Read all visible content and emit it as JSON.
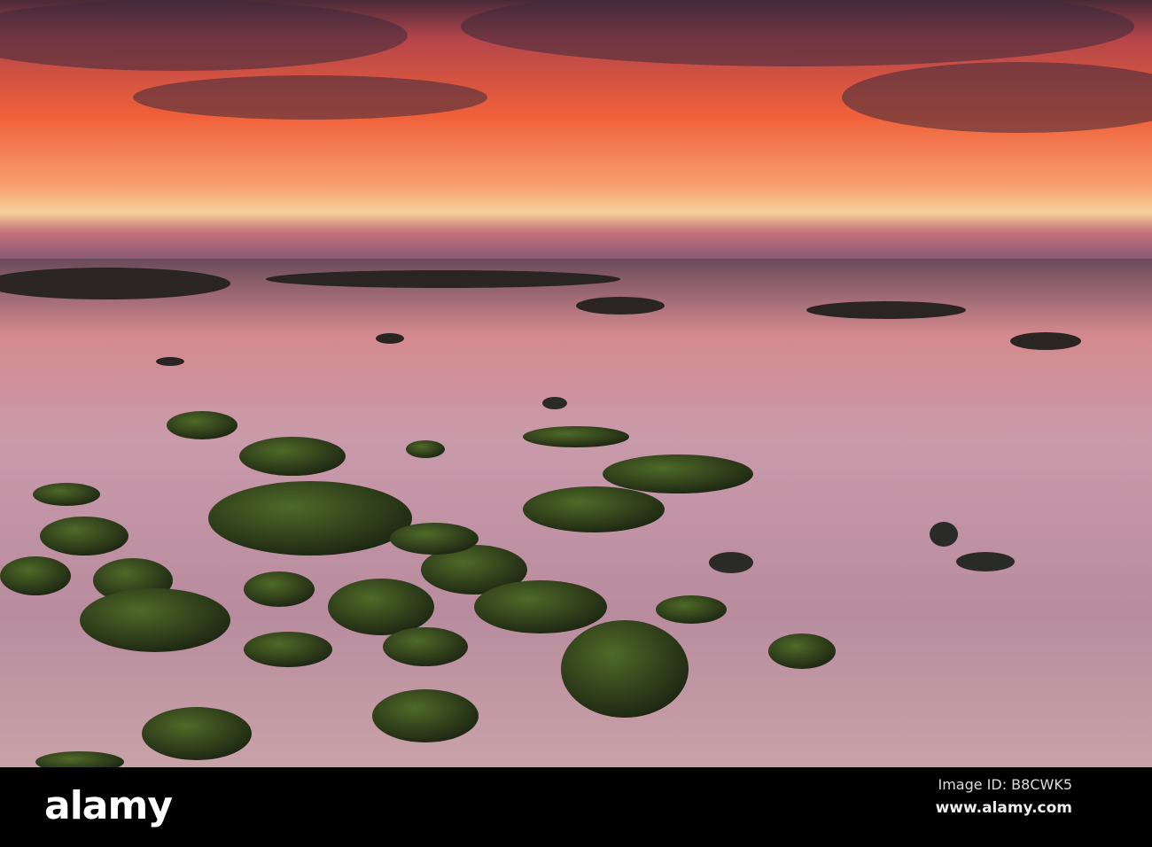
{
  "watermark": {
    "logo": "alamy",
    "image_id": "Image ID: B8CWK5",
    "url": "www.alamy.com"
  },
  "colors": {
    "sky_top": "#3a2530",
    "sky_glow": "#f0603a",
    "horizon": "#f6c98a",
    "sand": "#c79aa8",
    "rock": "#2f3a1e",
    "bar": "#000000"
  }
}
